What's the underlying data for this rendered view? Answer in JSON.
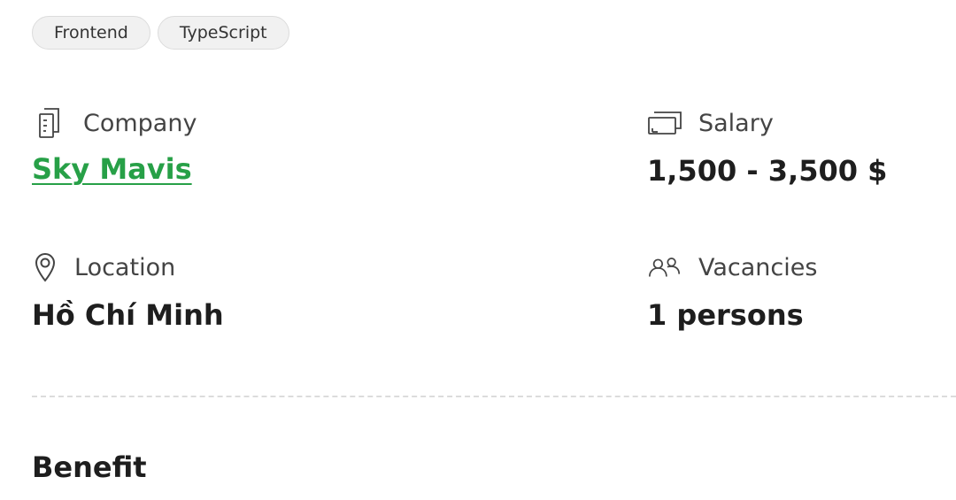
{
  "tags": [
    "Frontend",
    "TypeScript"
  ],
  "company": {
    "label": "Company",
    "value": "Sky Mavis",
    "icon": "building-icon"
  },
  "salary": {
    "label": "Salary",
    "value": "1,500 - 3,500 $",
    "icon": "wallet-icon"
  },
  "location": {
    "label": "Location",
    "value": "Hồ Chí Minh",
    "icon": "map-pin-icon"
  },
  "vacancies": {
    "label": "Vacancies",
    "value": "1 persons",
    "icon": "users-icon"
  },
  "benefit": {
    "title": "Benefit"
  },
  "colors": {
    "link": "#27a047",
    "tag_bg": "#f1f1f1",
    "divider": "#dcdcdc"
  }
}
